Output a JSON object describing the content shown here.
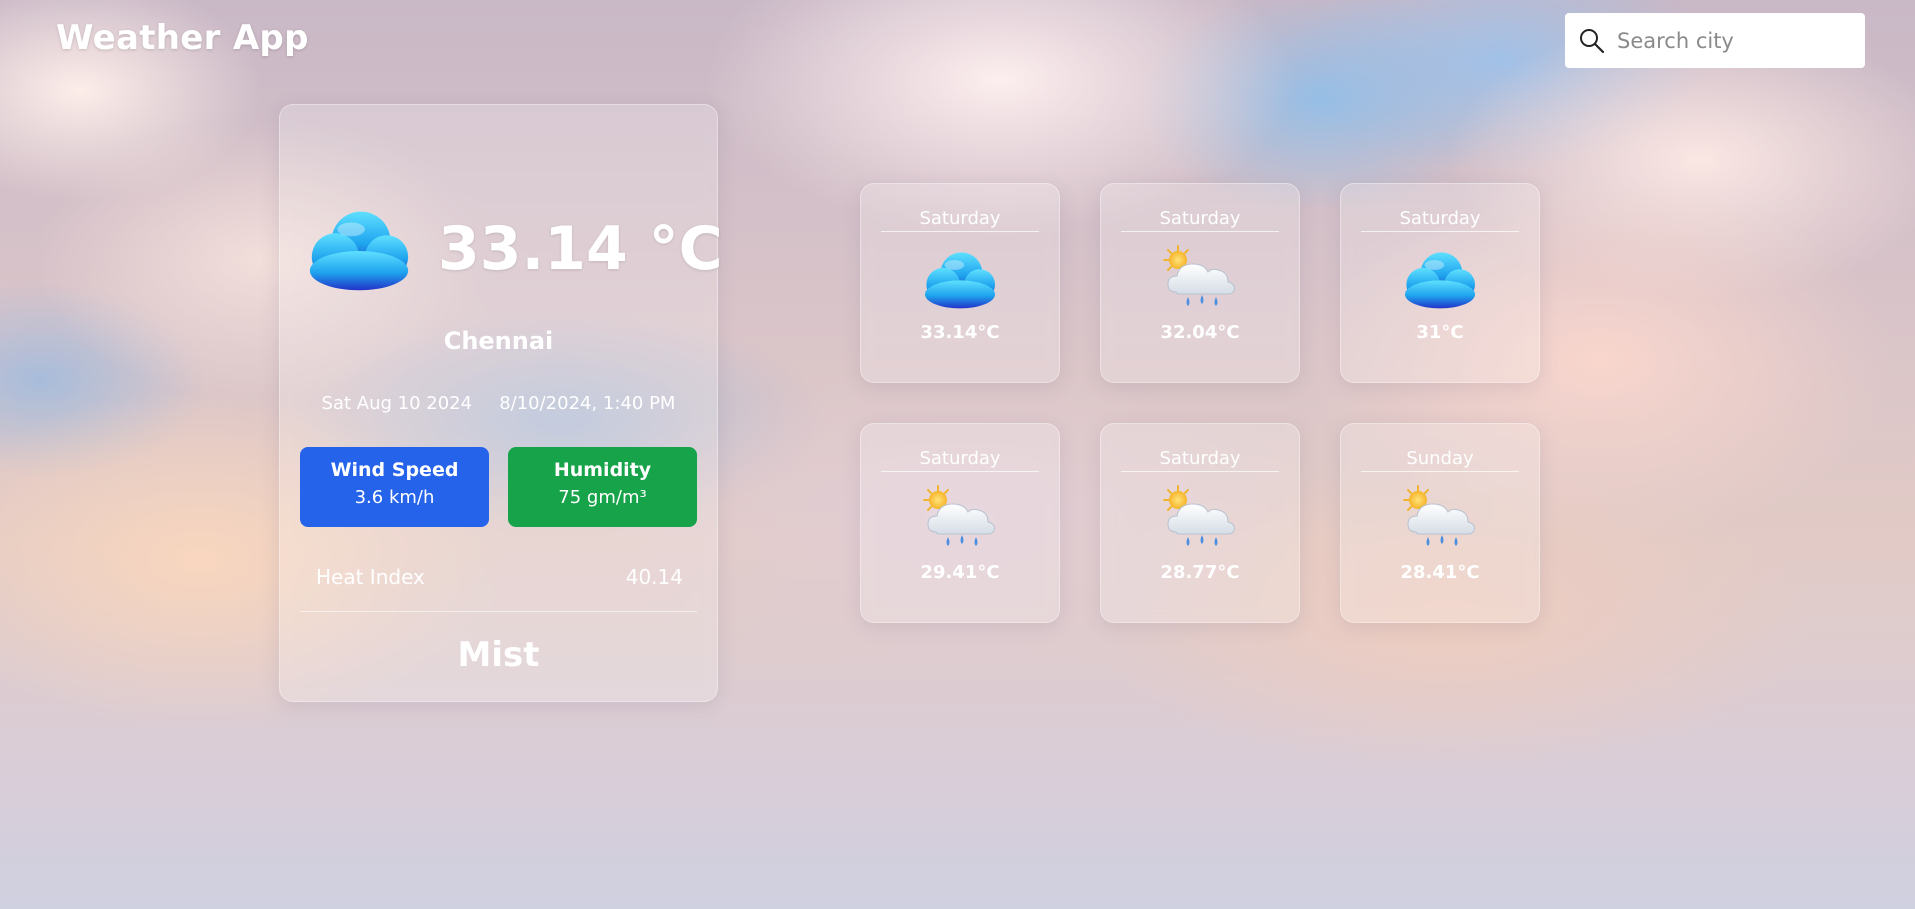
{
  "app": {
    "title": "Weather App"
  },
  "search": {
    "placeholder": "Search city",
    "value": ""
  },
  "current": {
    "temperature": "33.14 °C",
    "city": "Chennai",
    "date": "Sat Aug 10 2024",
    "datetime": "8/10/2024, 1:40 PM",
    "icon": "cloud-icon",
    "wind": {
      "label": "Wind Speed",
      "value": "3.6 km/h"
    },
    "humidity": {
      "label": "Humidity",
      "value": "75 gm/m³"
    },
    "heat_index": {
      "label": "Heat Index",
      "value": "40.14"
    },
    "condition": "Mist"
  },
  "forecast": [
    {
      "day": "Saturday",
      "temp": "33.14°C",
      "icon": "cloud-icon"
    },
    {
      "day": "Saturday",
      "temp": "32.04°C",
      "icon": "sun-rain-cloud-icon"
    },
    {
      "day": "Saturday",
      "temp": "31°C",
      "icon": "cloud-icon"
    },
    {
      "day": "Saturday",
      "temp": "29.41°C",
      "icon": "sun-rain-cloud-icon"
    },
    {
      "day": "Saturday",
      "temp": "28.77°C",
      "icon": "sun-rain-cloud-icon"
    },
    {
      "day": "Sunday",
      "temp": "28.41°C",
      "icon": "sun-rain-cloud-icon"
    }
  ],
  "colors": {
    "wind_bg": "#2563eb",
    "humidity_bg": "#16a34a",
    "text": "#ffffff"
  }
}
